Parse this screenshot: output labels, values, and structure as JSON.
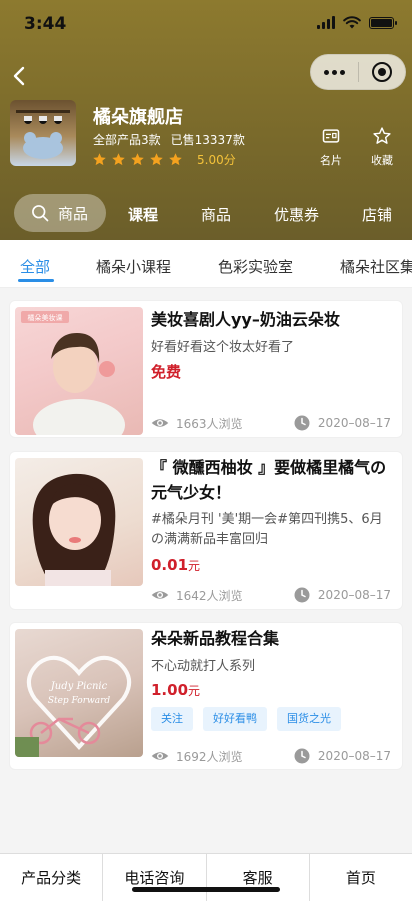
{
  "status": {
    "time": "3:44"
  },
  "store": {
    "name": "橘朵旗舰店",
    "products": "全部产品3款",
    "sold": "已售13337款",
    "rating": 5,
    "score": "5.00分"
  },
  "header_actions": [
    {
      "label": "名片",
      "icon": "id-card-icon"
    },
    {
      "label": "收藏",
      "icon": "star-outline-icon"
    }
  ],
  "top_tabs": {
    "search_label": "商品",
    "items": [
      "课程",
      "商品",
      "优惠券",
      "店铺"
    ],
    "active": "课程"
  },
  "sub_tabs": {
    "items": [
      "全部",
      "橘朵小课程",
      "色彩实验室",
      "橘朵社区集"
    ],
    "active": "全部"
  },
  "courses": [
    {
      "title": "美妆喜剧人yy–奶油云朵妆",
      "desc": "好看好看这个妆太好看了",
      "price": "免费",
      "price_unit": "",
      "tags": [],
      "views": "1663人浏览",
      "date": "2020–08–17",
      "thumb_text": "橘朵美妆课"
    },
    {
      "title": "『 微醺西柚妆 』要做橘里橘气の元气少女！",
      "desc": "#橘朵月刊 '美'期一会#第四刊携5、6月の满满新品丰富回归",
      "price": "0.01",
      "price_unit": "元",
      "tags": [],
      "views": "1642人浏览",
      "date": "2020–08–17",
      "thumb_text": ""
    },
    {
      "title": "朵朵新品教程合集",
      "desc": "不心动就打人系列",
      "price": "1.00",
      "price_unit": "元",
      "tags": [
        "关注",
        "好好看鸭",
        "国货之光"
      ],
      "views": "1692人浏览",
      "date": "2020–08–17",
      "thumb_text": "Judy Picnic Step Forward"
    }
  ],
  "bottom_bar": [
    "产品分类",
    "电话咨询",
    "客服",
    "首页"
  ],
  "colors": {
    "accent": "#2b8ee6",
    "price": "#d0202b",
    "header": "#7a6a2b",
    "star": "#f4c23a"
  }
}
